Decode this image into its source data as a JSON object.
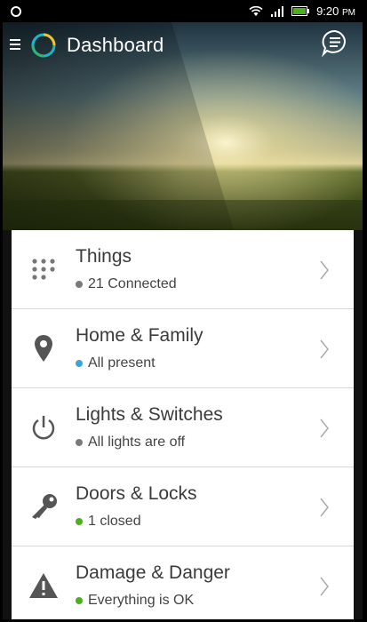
{
  "status_bar": {
    "time": "9:20",
    "ampm": "PM"
  },
  "header": {
    "title": "Dashboard",
    "icons": [
      "menu-icon",
      "logo-icon",
      "chat-icon"
    ]
  },
  "items": [
    {
      "title": "Things",
      "subtitle": "21 Connected",
      "icon": "grid-dots-icon",
      "status_color": "#7a7a7a"
    },
    {
      "title": "Home & Family",
      "subtitle": "All present",
      "icon": "location-pin-icon",
      "status_color": "#3aa6d8"
    },
    {
      "title": "Lights & Switches",
      "subtitle": "All lights are off",
      "icon": "power-icon",
      "status_color": "#7a7a7a"
    },
    {
      "title": "Doors & Locks",
      "subtitle": "1 closed",
      "icon": "key-icon",
      "status_color": "#4caf1f"
    },
    {
      "title": "Damage & Danger",
      "subtitle": "Everything is OK",
      "icon": "warning-icon",
      "status_color": "#4caf1f"
    }
  ],
  "colors": {
    "accent_teal": "#19b7c9",
    "accent_yellow": "#f2c12e",
    "icon_gray": "#555555"
  }
}
